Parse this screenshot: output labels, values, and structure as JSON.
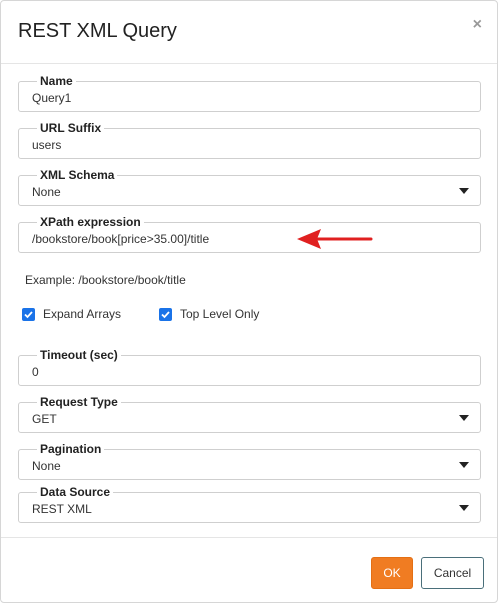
{
  "dialog": {
    "title": "REST XML Query",
    "close_glyph": "×"
  },
  "fields": {
    "name": {
      "label": "Name",
      "value": "Query1"
    },
    "url_suffix": {
      "label": "URL Suffix",
      "value": "users"
    },
    "xml_schema": {
      "label": "XML Schema",
      "value": "None"
    },
    "xpath": {
      "label": "XPath expression",
      "value": "/bookstore/book[price>35.00]/title"
    },
    "timeout": {
      "label": "Timeout (sec)",
      "value": "0"
    },
    "request_type": {
      "label": "Request Type",
      "value": "GET"
    },
    "pagination": {
      "label": "Pagination",
      "value": "None"
    },
    "data_source": {
      "label": "Data Source",
      "value": "REST XML"
    }
  },
  "example_text": "Example: /bookstore/book/title",
  "checkboxes": {
    "expand_arrays": {
      "label": "Expand Arrays",
      "checked": true
    },
    "top_level_only": {
      "label": "Top Level Only",
      "checked": true
    }
  },
  "buttons": {
    "ok": "OK",
    "cancel": "Cancel"
  },
  "colors": {
    "accent_ok": "#f07c22",
    "checkbox": "#1a73e8",
    "annotation_arrow": "#e02020"
  },
  "icons": {
    "close": "close-icon",
    "dropdown": "chevron-down-icon",
    "check": "checkmark-icon",
    "annotation": "red-arrow-annotation"
  }
}
